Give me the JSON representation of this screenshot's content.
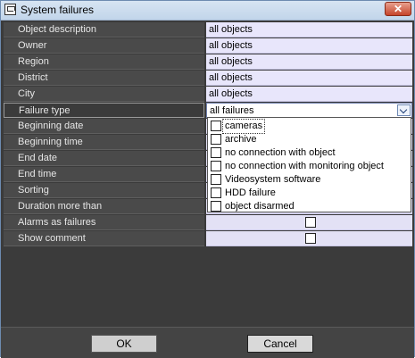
{
  "window": {
    "title": "System failures",
    "close_glyph": "✕"
  },
  "properties": [
    {
      "label": "Object description",
      "value": "all objects",
      "type": "text"
    },
    {
      "label": "Owner",
      "value": "all objects",
      "type": "text"
    },
    {
      "label": "Region",
      "value": "all objects",
      "type": "text"
    },
    {
      "label": "District",
      "value": "all objects",
      "type": "text"
    },
    {
      "label": "City",
      "value": "all objects",
      "type": "text"
    },
    {
      "label": "Failure type",
      "value": "all failures",
      "type": "dropdown"
    },
    {
      "label": "Beginning date",
      "value": "",
      "type": "text"
    },
    {
      "label": "Beginning time",
      "value": "",
      "type": "text"
    },
    {
      "label": "End date",
      "value": "",
      "type": "text"
    },
    {
      "label": "End time",
      "value": "",
      "type": "text"
    },
    {
      "label": "Sorting",
      "value": "",
      "type": "text"
    },
    {
      "label": "Duration more than",
      "value": "",
      "type": "text"
    },
    {
      "label": "Alarms as failures",
      "value": "",
      "type": "checkbox",
      "checked": false
    },
    {
      "label": "Show comment",
      "value": "",
      "type": "checkbox",
      "checked": false
    }
  ],
  "failure_dropdown": {
    "options": [
      {
        "label": "cameras",
        "checked": false
      },
      {
        "label": "archive",
        "checked": false
      },
      {
        "label": "no connection with object",
        "checked": false
      },
      {
        "label": "no connection with monitoring object",
        "checked": false
      },
      {
        "label": "Videosystem software",
        "checked": false
      },
      {
        "label": "HDD failure",
        "checked": false
      },
      {
        "label": "object disarmed",
        "checked": false
      }
    ]
  },
  "buttons": {
    "ok_label": "OK",
    "cancel_label": "Cancel"
  },
  "colors": {
    "label_bg": "#4a4a4a",
    "value_bg": "#e8e6fb",
    "window_bg": "#3b3b3b",
    "close_button": "#c5442a"
  },
  "icons": {
    "app": "report-window-icon",
    "close": "close-icon",
    "dropdown": "chevron-down-icon"
  }
}
